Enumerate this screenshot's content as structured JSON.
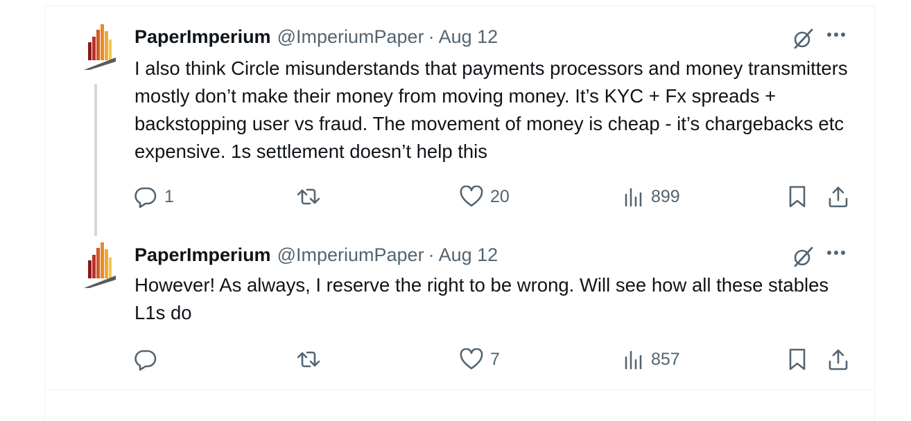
{
  "tweets": [
    {
      "display_name": "PaperImperium",
      "handle": "@ImperiumPaper",
      "separator": "·",
      "date": "Aug 12",
      "text": "I also think Circle misunderstands that payments processors and money transmitters mostly don’t make their money from moving money. It’s KYC + Fx spreads + backstopping user vs fraud. The movement of money is cheap - it’s chargebacks etc expensive. 1s settlement doesn’t help this",
      "replies": "1",
      "retweets": "",
      "likes": "20",
      "views": "899"
    },
    {
      "display_name": "PaperImperium",
      "handle": "@ImperiumPaper",
      "separator": "·",
      "date": "Aug 12",
      "text": "However! As always, I reserve the right to be wrong. Will see how all these stables L1s do",
      "replies": "",
      "retweets": "",
      "likes": "7",
      "views": "857"
    }
  ],
  "icons": {
    "reply": "reply-icon",
    "retweet": "retweet-icon",
    "like": "heart-icon",
    "views": "views-icon",
    "bookmark": "bookmark-icon",
    "share": "share-icon",
    "grok": "grok-icon",
    "more": "more-icon"
  },
  "colors": {
    "text": "#0f1419",
    "secondary": "#536471",
    "border": "#eff3f4",
    "thread_line": "#cfd9de"
  }
}
